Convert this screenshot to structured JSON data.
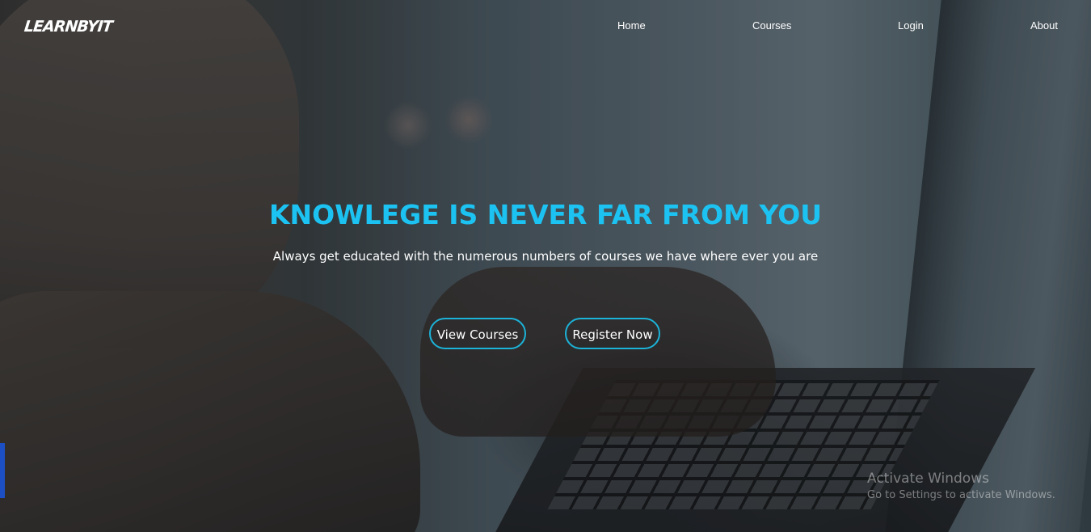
{
  "brand": {
    "logo_text": "LEARNBYIT",
    "accent_color": "#1cc3f2",
    "button_border_color": "#1cb3d8"
  },
  "nav": {
    "items": [
      {
        "label": "Home"
      },
      {
        "label": "Courses"
      },
      {
        "label": "Login"
      },
      {
        "label": "About"
      }
    ]
  },
  "hero": {
    "headline": "KNOWLEGE IS NEVER FAR FROM YOU",
    "subheadline": "Always get educated with the numerous numbers of courses we have where ever you are",
    "buttons": {
      "view_courses": "View Courses",
      "register_now": "Register Now"
    }
  },
  "watermark": {
    "title": "Activate Windows",
    "subtitle": "Go to Settings to activate Windows."
  }
}
